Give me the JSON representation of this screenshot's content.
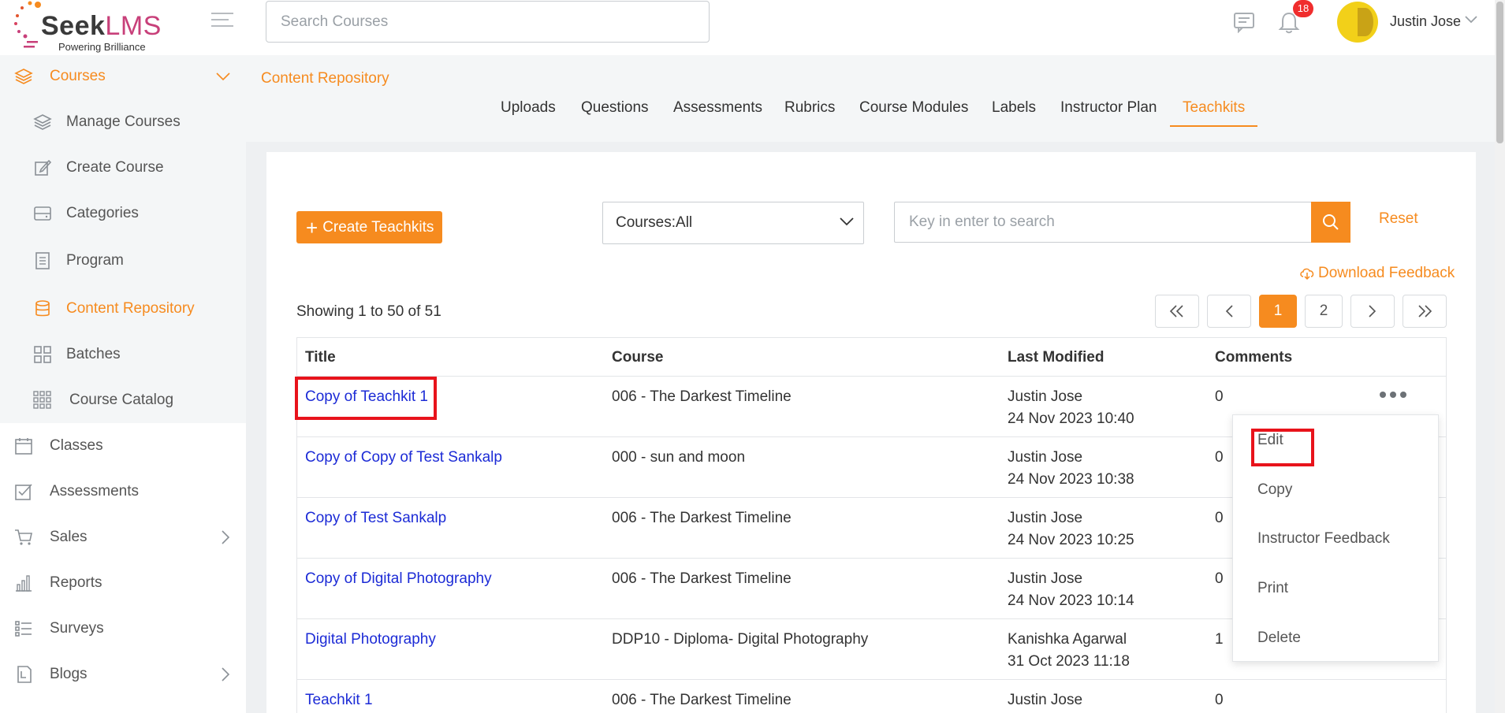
{
  "header": {
    "brand_seek": "Seek",
    "brand_lms": "LMS",
    "tagline": "Powering Brilliance",
    "search_placeholder": "Search Courses",
    "notification_count": "18",
    "user_name": "Justin Jose"
  },
  "sidebar": {
    "items": [
      {
        "label": "Courses",
        "icon": "layers-icon",
        "active": true
      },
      {
        "label": "Manage Courses",
        "icon": "layers-icon"
      },
      {
        "label": "Create Course",
        "icon": "edit-icon"
      },
      {
        "label": "Categories",
        "icon": "drawer-icon"
      },
      {
        "label": "Program",
        "icon": "document-icon"
      },
      {
        "label": "Content Repository",
        "icon": "database-icon",
        "active": true
      },
      {
        "label": "Batches",
        "icon": "grid-icon"
      },
      {
        "label": "Course Catalog",
        "icon": "grid-9-icon"
      },
      {
        "label": "Classes",
        "icon": "calendar-icon"
      },
      {
        "label": "Assessments",
        "icon": "checkbox-icon"
      },
      {
        "label": "Sales",
        "icon": "cart-icon"
      },
      {
        "label": "Reports",
        "icon": "bar-chart-icon"
      },
      {
        "label": "Surveys",
        "icon": "list-icon"
      },
      {
        "label": "Blogs",
        "icon": "blog-icon"
      }
    ]
  },
  "breadcrumb": "Content Repository",
  "tabs": [
    "Uploads",
    "Questions",
    "Assessments",
    "Rubrics",
    "Course Modules",
    "Labels",
    "Instructor Plan",
    "Teachkits"
  ],
  "active_tab": "Teachkits",
  "toolbar": {
    "create_label": "Create Teachkits",
    "course_filter": "Courses:All",
    "search_placeholder": "Key in enter to search",
    "reset_label": "Reset",
    "download_label": "Download Feedback"
  },
  "showing_text": "Showing 1 to 50 of 51",
  "pagination": {
    "pages": [
      "1",
      "2"
    ],
    "current": "1"
  },
  "table": {
    "headers": [
      "Title",
      "Course",
      "Last Modified",
      "Comments"
    ],
    "rows": [
      {
        "title": "Copy of Teachkit 1",
        "course": "006 - The Darkest Timeline",
        "author": "Justin Jose",
        "date": "24 Nov 2023 10:40",
        "comments": "0"
      },
      {
        "title": "Copy of Copy of Test Sankalp",
        "course": "000 - sun and moon",
        "author": "Justin Jose",
        "date": "24 Nov 2023 10:38",
        "comments": "0"
      },
      {
        "title": "Copy of Test Sankalp",
        "course": "006 - The Darkest Timeline",
        "author": "Justin Jose",
        "date": "24 Nov 2023 10:25",
        "comments": "0"
      },
      {
        "title": "Copy of Digital Photography",
        "course": "006 - The Darkest Timeline",
        "author": "Justin Jose",
        "date": "24 Nov 2023 10:14",
        "comments": "0"
      },
      {
        "title": "Digital Photography",
        "course": "DDP10 - Diploma- Digital Photography",
        "author": "Kanishka Agarwal",
        "date": "31 Oct 2023 11:18",
        "comments": "1"
      },
      {
        "title": "Teachkit 1",
        "course": "006 - The Darkest Timeline",
        "author": "Justin Jose",
        "date": "",
        "comments": "0"
      }
    ]
  },
  "row_menu": [
    "Edit",
    "Copy",
    "Instructor Feedback",
    "Print",
    "Delete"
  ],
  "colors": {
    "accent": "#f68b1f",
    "link": "#1c2bd6",
    "highlight": "#e8131b",
    "badge": "#f02d2d"
  }
}
